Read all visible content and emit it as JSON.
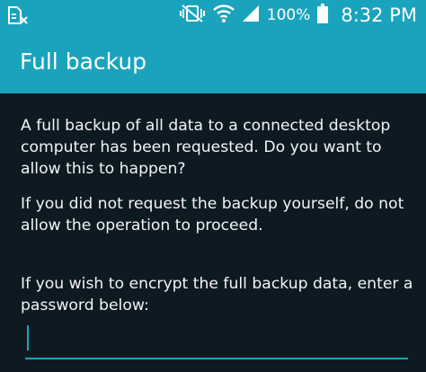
{
  "status_bar": {
    "notification_icon": "sim-card-x-icon",
    "mute_icon": "vibrate-mute-icon",
    "wifi_icon": "wifi-icon",
    "signal_icon": "cell-signal-icon",
    "battery_text": "100%",
    "battery_icon": "battery-full-icon",
    "time": "8:32 PM"
  },
  "dialog": {
    "title": "Full backup",
    "paragraph1": "A full backup of all data to a connected desktop computer has been requested. Do you want to allow this to happen?",
    "paragraph2": "If you did not request the backup yourself, do not allow the operation to proceed.",
    "paragraph3": "If you wish to encrypt the full backup data, enter a password below:",
    "password_value": ""
  },
  "colors": {
    "accent": "#1aa3bd",
    "background": "#0e1a22",
    "text": "#f2f4f5"
  }
}
